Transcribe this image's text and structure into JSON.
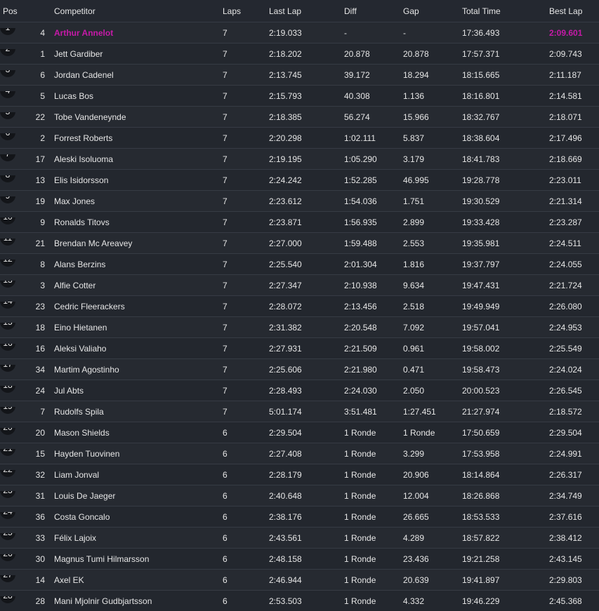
{
  "columns": {
    "pos": "Pos",
    "competitor": "Competitor",
    "laps": "Laps",
    "last_lap": "Last Lap",
    "diff": "Diff",
    "gap": "Gap",
    "total_time": "Total Time",
    "best_lap": "Best Lap"
  },
  "highlight_color": "#c61aa8",
  "rows": [
    {
      "pos": "1",
      "no": "4",
      "name": "Arthur Annelot",
      "laps": "7",
      "last": "2:19.033",
      "diff": "-",
      "gap": "-",
      "total": "17:36.493",
      "best": "2:09.601"
    },
    {
      "pos": "2",
      "no": "1",
      "name": "Jett Gardiber",
      "laps": "7",
      "last": "2:18.202",
      "diff": "20.878",
      "gap": "20.878",
      "total": "17:57.371",
      "best": "2:09.743"
    },
    {
      "pos": "3",
      "no": "6",
      "name": "Jordan Cadenel",
      "laps": "7",
      "last": "2:13.745",
      "diff": "39.172",
      "gap": "18.294",
      "total": "18:15.665",
      "best": "2:11.187"
    },
    {
      "pos": "4",
      "no": "5",
      "name": "Lucas Bos",
      "laps": "7",
      "last": "2:15.793",
      "diff": "40.308",
      "gap": "1.136",
      "total": "18:16.801",
      "best": "2:14.581"
    },
    {
      "pos": "5",
      "no": "22",
      "name": "Tobe Vandeneynde",
      "laps": "7",
      "last": "2:18.385",
      "diff": "56.274",
      "gap": "15.966",
      "total": "18:32.767",
      "best": "2:18.071"
    },
    {
      "pos": "6",
      "no": "2",
      "name": "Forrest Roberts",
      "laps": "7",
      "last": "2:20.298",
      "diff": "1:02.111",
      "gap": "5.837",
      "total": "18:38.604",
      "best": "2:17.496"
    },
    {
      "pos": "7",
      "no": "17",
      "name": "Aleski Isoluoma",
      "laps": "7",
      "last": "2:19.195",
      "diff": "1:05.290",
      "gap": "3.179",
      "total": "18:41.783",
      "best": "2:18.669"
    },
    {
      "pos": "8",
      "no": "13",
      "name": "Elis Isidorsson",
      "laps": "7",
      "last": "2:24.242",
      "diff": "1:52.285",
      "gap": "46.995",
      "total": "19:28.778",
      "best": "2:23.011"
    },
    {
      "pos": "9",
      "no": "19",
      "name": "Max Jones",
      "laps": "7",
      "last": "2:23.612",
      "diff": "1:54.036",
      "gap": "1.751",
      "total": "19:30.529",
      "best": "2:21.314"
    },
    {
      "pos": "10",
      "no": "9",
      "name": "Ronalds Titovs",
      "laps": "7",
      "last": "2:23.871",
      "diff": "1:56.935",
      "gap": "2.899",
      "total": "19:33.428",
      "best": "2:23.287"
    },
    {
      "pos": "11",
      "no": "21",
      "name": "Brendan Mc Areavey",
      "laps": "7",
      "last": "2:27.000",
      "diff": "1:59.488",
      "gap": "2.553",
      "total": "19:35.981",
      "best": "2:24.511"
    },
    {
      "pos": "12",
      "no": "8",
      "name": "Alans Berzins",
      "laps": "7",
      "last": "2:25.540",
      "diff": "2:01.304",
      "gap": "1.816",
      "total": "19:37.797",
      "best": "2:24.055"
    },
    {
      "pos": "13",
      "no": "3",
      "name": "Alfie Cotter",
      "laps": "7",
      "last": "2:27.347",
      "diff": "2:10.938",
      "gap": "9.634",
      "total": "19:47.431",
      "best": "2:21.724"
    },
    {
      "pos": "14",
      "no": "23",
      "name": "Cedric Fleerackers",
      "laps": "7",
      "last": "2:28.072",
      "diff": "2:13.456",
      "gap": "2.518",
      "total": "19:49.949",
      "best": "2:26.080"
    },
    {
      "pos": "15",
      "no": "18",
      "name": "Eino Hietanen",
      "laps": "7",
      "last": "2:31.382",
      "diff": "2:20.548",
      "gap": "7.092",
      "total": "19:57.041",
      "best": "2:24.953"
    },
    {
      "pos": "16",
      "no": "16",
      "name": "Aleksi Valiaho",
      "laps": "7",
      "last": "2:27.931",
      "diff": "2:21.509",
      "gap": "0.961",
      "total": "19:58.002",
      "best": "2:25.549"
    },
    {
      "pos": "17",
      "no": "34",
      "name": "Martim Agostinho",
      "laps": "7",
      "last": "2:25.606",
      "diff": "2:21.980",
      "gap": "0.471",
      "total": "19:58.473",
      "best": "2:24.024"
    },
    {
      "pos": "18",
      "no": "24",
      "name": "Jul Abts",
      "laps": "7",
      "last": "2:28.493",
      "diff": "2:24.030",
      "gap": "2.050",
      "total": "20:00.523",
      "best": "2:26.545"
    },
    {
      "pos": "19",
      "no": "7",
      "name": "Rudolfs Spila",
      "laps": "7",
      "last": "5:01.174",
      "diff": "3:51.481",
      "gap": "1:27.451",
      "total": "21:27.974",
      "best": "2:18.572"
    },
    {
      "pos": "20",
      "no": "20",
      "name": "Mason Shields",
      "laps": "6",
      "last": "2:29.504",
      "diff": "1 Ronde",
      "gap": "1 Ronde",
      "total": "17:50.659",
      "best": "2:29.504"
    },
    {
      "pos": "21",
      "no": "15",
      "name": "Hayden Tuovinen",
      "laps": "6",
      "last": "2:27.408",
      "diff": "1 Ronde",
      "gap": "3.299",
      "total": "17:53.958",
      "best": "2:24.991"
    },
    {
      "pos": "22",
      "no": "32",
      "name": "Liam Jonval",
      "laps": "6",
      "last": "2:28.179",
      "diff": "1 Ronde",
      "gap": "20.906",
      "total": "18:14.864",
      "best": "2:26.317"
    },
    {
      "pos": "23",
      "no": "31",
      "name": "Louis De Jaeger",
      "laps": "6",
      "last": "2:40.648",
      "diff": "1 Ronde",
      "gap": "12.004",
      "total": "18:26.868",
      "best": "2:34.749"
    },
    {
      "pos": "24",
      "no": "36",
      "name": "Costa Goncalo",
      "laps": "6",
      "last": "2:38.176",
      "diff": "1 Ronde",
      "gap": "26.665",
      "total": "18:53.533",
      "best": "2:37.616"
    },
    {
      "pos": "25",
      "no": "33",
      "name": "Félix Lajoix",
      "laps": "6",
      "last": "2:43.561",
      "diff": "1 Ronde",
      "gap": "4.289",
      "total": "18:57.822",
      "best": "2:38.412"
    },
    {
      "pos": "26",
      "no": "30",
      "name": "Magnus Tumi Hilmarsson",
      "laps": "6",
      "last": "2:48.158",
      "diff": "1 Ronde",
      "gap": "23.436",
      "total": "19:21.258",
      "best": "2:43.145"
    },
    {
      "pos": "27",
      "no": "14",
      "name": "Axel EK",
      "laps": "6",
      "last": "2:46.944",
      "diff": "1 Ronde",
      "gap": "20.639",
      "total": "19:41.897",
      "best": "2:29.803"
    },
    {
      "pos": "28",
      "no": "28",
      "name": "Mani Mjolnir Gudbjartsson",
      "laps": "6",
      "last": "2:53.503",
      "diff": "1 Ronde",
      "gap": "4.332",
      "total": "19:46.229",
      "best": "2:45.368"
    }
  ]
}
